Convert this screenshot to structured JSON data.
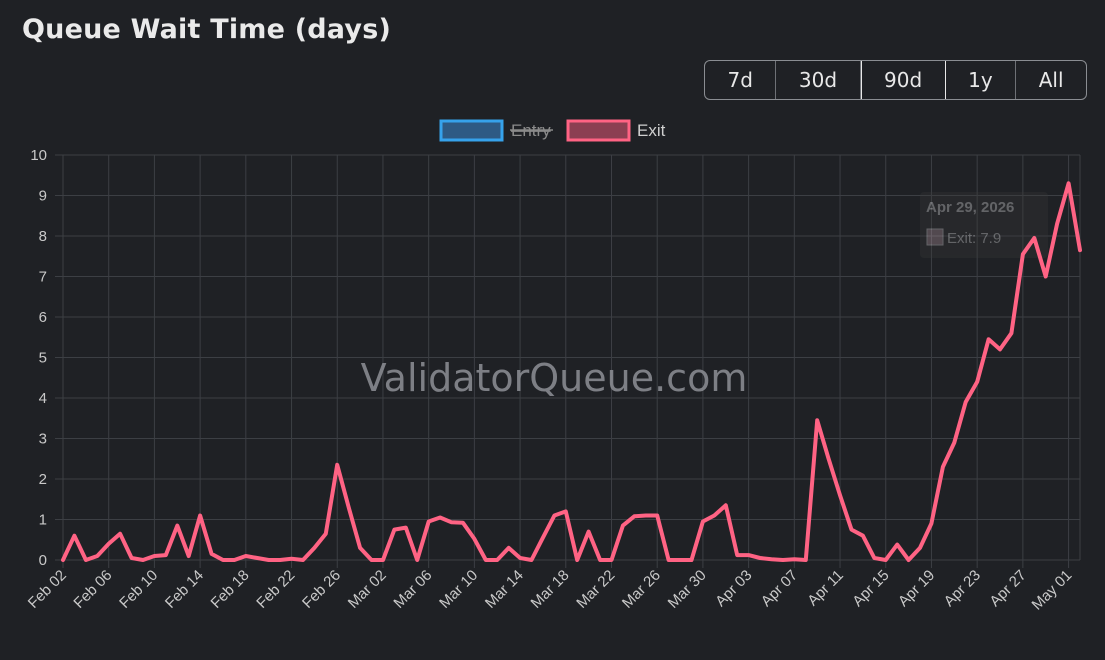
{
  "header": {
    "title": "Queue Wait Time (days)"
  },
  "range_buttons": [
    {
      "label": "7d",
      "active": false
    },
    {
      "label": "30d",
      "active": false
    },
    {
      "label": "90d",
      "active": true
    },
    {
      "label": "1y",
      "active": false
    },
    {
      "label": "All",
      "active": false
    }
  ],
  "watermark": "ValidatorQueue.com",
  "tooltip": {
    "date": "Apr 29, 2026",
    "text": "Exit: 7.9"
  },
  "chart_data": {
    "type": "line",
    "title": "",
    "xlabel": "",
    "ylabel": "",
    "ylim": [
      0,
      10
    ],
    "yticks": [
      0,
      1,
      2,
      3,
      4,
      5,
      6,
      7,
      8,
      9,
      10
    ],
    "grid": true,
    "legend_position": "top-center",
    "x_start_label": "Feb 02",
    "x_ticks": [
      "Feb 02",
      "Feb 06",
      "Feb 10",
      "Feb 14",
      "Feb 18",
      "Feb 22",
      "Feb 26",
      "Mar 02",
      "Mar 06",
      "Mar 10",
      "Mar 14",
      "Mar 18",
      "Mar 22",
      "Mar 26",
      "Mar 30",
      "Apr 03",
      "Apr 07",
      "Apr 11",
      "Apr 15",
      "Apr 19",
      "Apr 23",
      "Apr 27",
      "May 01"
    ],
    "series": [
      {
        "name": "Entry",
        "hidden": true,
        "color": "#36a2eb",
        "values": []
      },
      {
        "name": "Exit",
        "hidden": false,
        "color": "#ff6384",
        "values": [
          0.0,
          0.6,
          0.0,
          0.1,
          0.4,
          0.65,
          0.05,
          0.0,
          0.1,
          0.12,
          0.85,
          0.1,
          1.1,
          0.15,
          0.0,
          0.0,
          0.1,
          0.05,
          0.0,
          0.0,
          0.03,
          0.0,
          0.3,
          0.65,
          2.35,
          1.3,
          0.3,
          0.0,
          0.0,
          0.75,
          0.8,
          0.0,
          0.95,
          1.05,
          0.93,
          0.92,
          0.52,
          0.0,
          0.0,
          0.3,
          0.05,
          0.0,
          0.55,
          1.1,
          1.2,
          0.0,
          0.7,
          0.0,
          0.0,
          0.85,
          1.08,
          1.1,
          1.1,
          0.0,
          0.0,
          0.0,
          0.95,
          1.1,
          1.35,
          0.12,
          0.12,
          0.05,
          0.02,
          0.0,
          0.02,
          0.0,
          3.45,
          2.5,
          1.6,
          0.75,
          0.6,
          0.05,
          0.0,
          0.38,
          0.0,
          0.3,
          0.9,
          2.3,
          2.9,
          3.9,
          4.4,
          5.45,
          5.2,
          5.6,
          7.55,
          7.95,
          7.0,
          8.3,
          9.3,
          7.65
        ]
      }
    ]
  }
}
